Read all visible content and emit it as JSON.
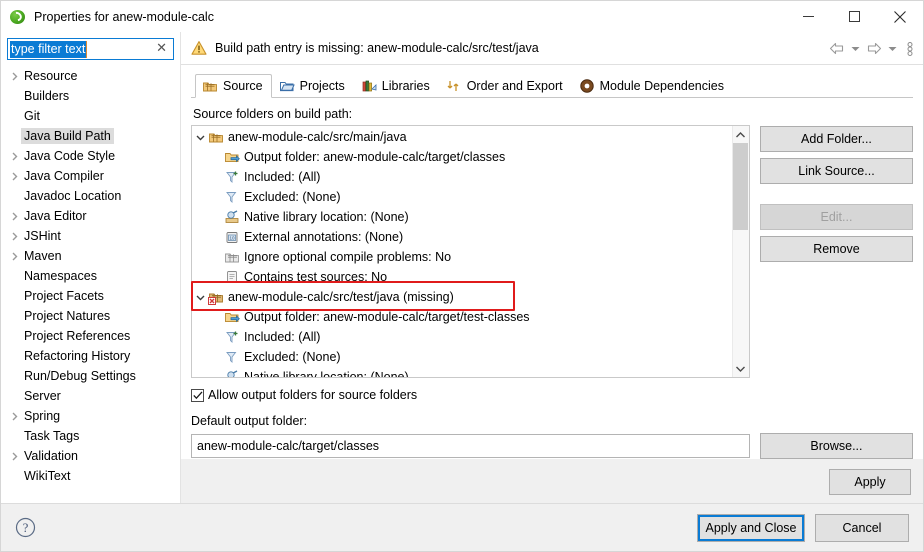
{
  "window": {
    "title": "Properties for anew-module-calc",
    "icon": "eclipse-globe-icon",
    "minimize_label": "Minimize",
    "maximize_label": "Maximize",
    "close_label": "Close"
  },
  "sidebar": {
    "filter": {
      "value": "type filter text",
      "placeholder": "type filter text",
      "clear_glyph": "✕"
    },
    "items": [
      {
        "label": "Resource",
        "expandable": true,
        "selected": false
      },
      {
        "label": "Builders",
        "expandable": false,
        "selected": false
      },
      {
        "label": "Git",
        "expandable": false,
        "selected": false
      },
      {
        "label": "Java Build Path",
        "expandable": false,
        "selected": true
      },
      {
        "label": "Java Code Style",
        "expandable": true,
        "selected": false
      },
      {
        "label": "Java Compiler",
        "expandable": true,
        "selected": false
      },
      {
        "label": "Javadoc Location",
        "expandable": false,
        "selected": false
      },
      {
        "label": "Java Editor",
        "expandable": true,
        "selected": false
      },
      {
        "label": "JSHint",
        "expandable": true,
        "selected": false
      },
      {
        "label": "Maven",
        "expandable": true,
        "selected": false
      },
      {
        "label": "Namespaces",
        "expandable": false,
        "selected": false
      },
      {
        "label": "Project Facets",
        "expandable": false,
        "selected": false
      },
      {
        "label": "Project Natures",
        "expandable": false,
        "selected": false
      },
      {
        "label": "Project References",
        "expandable": false,
        "selected": false
      },
      {
        "label": "Refactoring History",
        "expandable": false,
        "selected": false
      },
      {
        "label": "Run/Debug Settings",
        "expandable": false,
        "selected": false
      },
      {
        "label": "Server",
        "expandable": false,
        "selected": false
      },
      {
        "label": "Spring",
        "expandable": true,
        "selected": false
      },
      {
        "label": "Task Tags",
        "expandable": false,
        "selected": false
      },
      {
        "label": "Validation",
        "expandable": true,
        "selected": false
      },
      {
        "label": "WikiText",
        "expandable": false,
        "selected": false
      }
    ]
  },
  "message_bar": {
    "icon": "warning-icon",
    "text": "Build path entry is missing: anew-module-calc/src/test/java",
    "back_label": "Back",
    "forward_label": "Forward",
    "menu_label": "View Menu"
  },
  "tabs": [
    {
      "label": "Source",
      "icon": "source-folder-icon",
      "active": true
    },
    {
      "label": "Projects",
      "icon": "projects-folder-icon",
      "active": false
    },
    {
      "label": "Libraries",
      "icon": "libraries-books-icon",
      "active": false
    },
    {
      "label": "Order and Export",
      "icon": "order-export-arrows-icon",
      "active": false
    },
    {
      "label": "Module Dependencies",
      "icon": "module-dependencies-icon",
      "active": false
    }
  ],
  "main": {
    "section_label": "Source folders on build path:",
    "tree": [
      {
        "text": "anew-module-calc/src/main/java",
        "icon": "source-folder-icon",
        "level": 1,
        "expanded": true
      },
      {
        "text": "Output folder: anew-module-calc/target/classes",
        "icon": "output-folder-icon",
        "level": 2,
        "expanded": false
      },
      {
        "text": "Included: (All)",
        "icon": "included-filter-icon",
        "level": 2,
        "expanded": false
      },
      {
        "text": "Excluded: (None)",
        "icon": "excluded-filter-icon",
        "level": 2,
        "expanded": false
      },
      {
        "text": "Native library location: (None)",
        "icon": "native-library-icon",
        "level": 2,
        "expanded": false
      },
      {
        "text": "External annotations: (None)",
        "icon": "external-annotations-icon",
        "level": 2,
        "expanded": false
      },
      {
        "text": "Ignore optional compile problems: No",
        "icon": "ignore-problems-icon",
        "level": 2,
        "expanded": false
      },
      {
        "text": "Contains test sources: No",
        "icon": "test-sources-icon",
        "level": 2,
        "expanded": false
      },
      {
        "text": "anew-module-calc/src/test/java (missing)",
        "icon": "source-folder-missing-icon",
        "level": 1,
        "expanded": true
      },
      {
        "text": "Output folder: anew-module-calc/target/test-classes",
        "icon": "output-folder-icon",
        "level": 2,
        "expanded": false
      },
      {
        "text": "Included: (All)",
        "icon": "included-filter-icon",
        "level": 2,
        "expanded": false
      },
      {
        "text": "Excluded: (None)",
        "icon": "excluded-filter-icon",
        "level": 2,
        "expanded": false
      },
      {
        "text": "Native library location: (None)",
        "icon": "native-library-icon",
        "level": 2,
        "expanded": false
      }
    ],
    "side_buttons": [
      {
        "label": "Add Folder...",
        "enabled": true
      },
      {
        "label": "Link Source...",
        "enabled": true
      },
      {
        "label": "Edit...",
        "enabled": false
      },
      {
        "label": "Remove",
        "enabled": true
      }
    ],
    "allow_output_folders": {
      "label": "Allow output folders for source folders",
      "checked": true
    },
    "default_output_folder": {
      "label": "Default output folder:",
      "value": "anew-module-calc/target/classes",
      "browse_label": "Browse..."
    },
    "apply_label": "Apply"
  },
  "footer": {
    "help_label": "Help",
    "apply_and_close_label": "Apply and Close",
    "cancel_label": "Cancel"
  },
  "annotation": {
    "highlight_color": "#e01b1b",
    "highlighted_row": "anew-module-calc/src/test/java (missing)"
  }
}
